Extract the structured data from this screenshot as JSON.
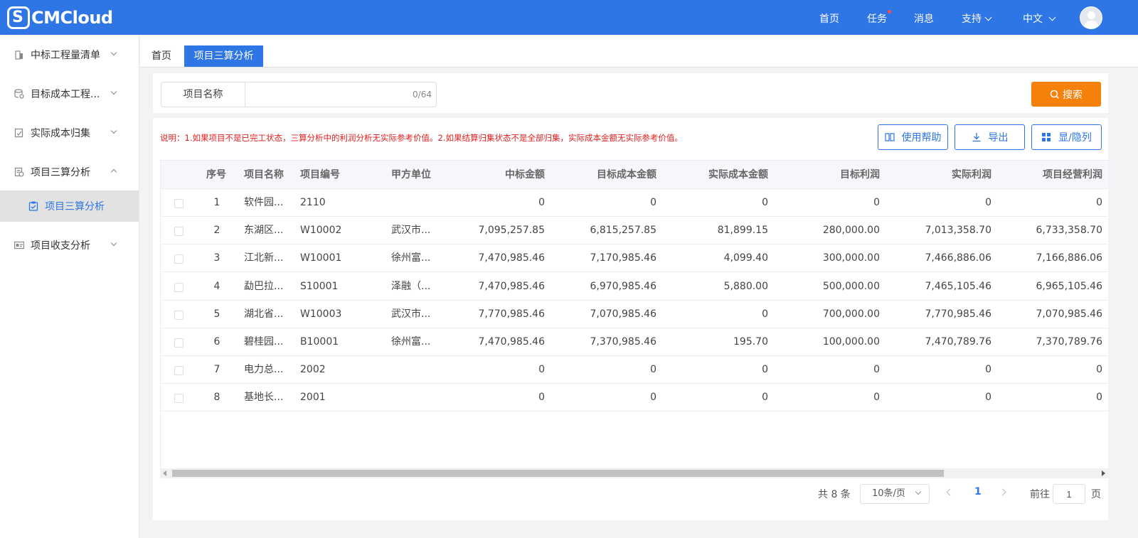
{
  "header": {
    "logo_text": "CMCloud",
    "logo_mark": "S",
    "nav": {
      "home": "首页",
      "tasks": "任务",
      "messages": "消息",
      "support": "支持",
      "language": "中文"
    }
  },
  "sidebar": {
    "items": [
      {
        "label": "中标工程量清单"
      },
      {
        "label": "目标成本工程..."
      },
      {
        "label": "实际成本归集"
      },
      {
        "label": "项目三算分析"
      },
      {
        "label": "项目收支分析"
      }
    ],
    "submenu": {
      "label": "项目三算分析"
    }
  },
  "tabs": {
    "home": "首页",
    "active": "项目三算分析"
  },
  "search": {
    "label": "项目名称",
    "value": "",
    "placeholder": "",
    "count": "0/64",
    "button": "搜索"
  },
  "note": "说明：1.如果项目不是已完工状态，三算分析中的利润分析无实际参考价值。2.如果结算归集状态不是全部归集，实际成本金额无实际参考价值。",
  "toolbar": {
    "help": "使用帮助",
    "export": "导出",
    "columns": "显/隐列"
  },
  "table": {
    "headers": [
      "序号",
      "项目名称",
      "项目编号",
      "甲方单位",
      "中标金额",
      "目标成本金额",
      "实际成本金额",
      "目标利润",
      "实际利润",
      "项目经营利润"
    ],
    "rows": [
      [
        "1",
        "软件园...",
        "2110",
        "",
        "0",
        "0",
        "0",
        "0",
        "0",
        "0"
      ],
      [
        "2",
        "东湖区...",
        "W10002",
        "武汉市...",
        "7,095,257.85",
        "6,815,257.85",
        "81,899.15",
        "280,000.00",
        "7,013,358.70",
        "6,733,358.70"
      ],
      [
        "3",
        "江北新...",
        "W10001",
        "徐州富...",
        "7,470,985.46",
        "7,170,985.46",
        "4,099.40",
        "300,000.00",
        "7,466,886.06",
        "7,166,886.06"
      ],
      [
        "4",
        "勐巴拉...",
        "S10001",
        "泽融（...",
        "7,470,985.46",
        "6,970,985.46",
        "5,880.00",
        "500,000.00",
        "7,465,105.46",
        "6,965,105.46"
      ],
      [
        "5",
        "湖北省...",
        "W10003",
        "武汉市...",
        "7,770,985.46",
        "7,070,985.46",
        "0",
        "700,000.00",
        "7,770,985.46",
        "7,070,985.46"
      ],
      [
        "6",
        "碧桂园...",
        "B10001",
        "徐州富...",
        "7,470,985.46",
        "7,370,985.46",
        "195.70",
        "100,000.00",
        "7,470,789.76",
        "7,370,789.76"
      ],
      [
        "7",
        "电力总...",
        "2002",
        "",
        "0",
        "0",
        "0",
        "0",
        "0",
        "0"
      ],
      [
        "8",
        "基地长...",
        "2001",
        "",
        "0",
        "0",
        "0",
        "0",
        "0",
        "0"
      ]
    ]
  },
  "pagination": {
    "total": "共 8 条",
    "page_size": "10条/页",
    "current_page": "1",
    "goto_label": "前往",
    "goto_value": "1",
    "goto_suffix": "页"
  },
  "colors": {
    "primary": "#2e75e6",
    "search_button": "#f5810a",
    "note_text": "#e02020"
  }
}
